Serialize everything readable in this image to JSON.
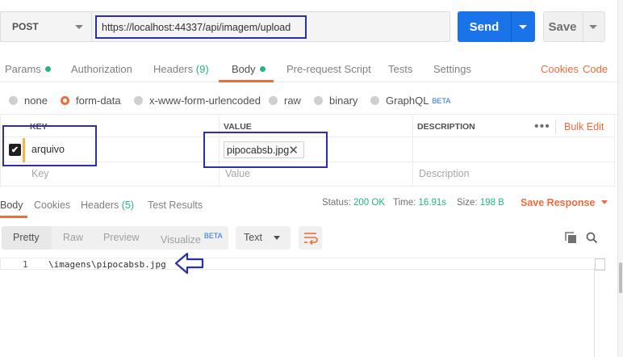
{
  "request": {
    "method": "POST",
    "url": "https://localhost:44337/api/imagem/upload",
    "send_label": "Send",
    "save_label": "Save"
  },
  "request_tabs": {
    "params": "Params",
    "authorization": "Authorization",
    "headers": "Headers",
    "headers_count": "(9)",
    "body": "Body",
    "prerequest": "Pre-request Script",
    "tests": "Tests",
    "settings": "Settings",
    "cookies": "Cookies",
    "code": "Code"
  },
  "body_types": {
    "none": "none",
    "form_data": "form-data",
    "urlencoded": "x-www-form-urlencoded",
    "raw": "raw",
    "binary": "binary",
    "graphql": "GraphQL",
    "beta": "BETA",
    "selected": "form-data"
  },
  "params_table": {
    "headers": {
      "key": "KEY",
      "value": "VALUE",
      "description": "DESCRIPTION",
      "bulk_edit": "Bulk Edit"
    },
    "rows": [
      {
        "checked": true,
        "key": "arquivo",
        "value": "pipocabsb.jpg"
      }
    ],
    "placeholders": {
      "key": "Key",
      "value": "Value",
      "description": "Description"
    }
  },
  "response_tabs": {
    "body": "Body",
    "cookies": "Cookies",
    "headers": "Headers",
    "headers_count": "(5)",
    "test_results": "Test Results"
  },
  "response_meta": {
    "status_label": "Status:",
    "status_value": "200 OK",
    "time_label": "Time:",
    "time_value": "16.91s",
    "size_label": "Size:",
    "size_value": "198 B",
    "save_response": "Save Response"
  },
  "response_view": {
    "pretty": "Pretty",
    "raw": "Raw",
    "preview": "Preview",
    "visualize": "Visualize",
    "beta": "BETA",
    "format": "Text"
  },
  "response_body": {
    "line_number": "1",
    "text": "\\imagens\\pipocabsb.jpg"
  },
  "colors": {
    "accent": "#f26b3a",
    "primary": "#1a73e8",
    "success": "#26b47f",
    "annotation": "#2b2fa8"
  }
}
